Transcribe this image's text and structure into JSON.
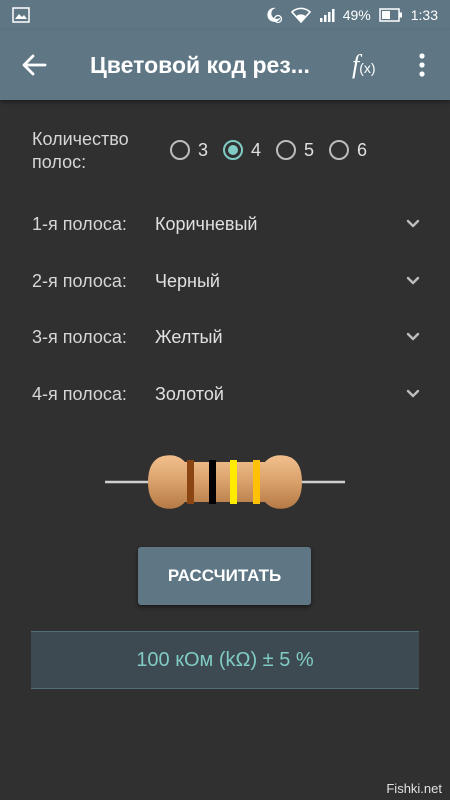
{
  "status_bar": {
    "battery": "49%",
    "time": "1:33",
    "icons": [
      "image-icon",
      "alarm-icon",
      "wifi-icon",
      "signal-icon",
      "battery-icon"
    ]
  },
  "app_bar": {
    "title": "Цветовой код рез...",
    "fx_label": "f",
    "fx_sub": "(x)",
    "icons": [
      "back-arrow-icon",
      "function-icon",
      "more-vert-icon"
    ]
  },
  "band_count": {
    "label": "Количество полос:",
    "options": [
      "3",
      "4",
      "5",
      "6"
    ],
    "selected": "4"
  },
  "bands": [
    {
      "label": "1-я полоса:",
      "value": "Коричневый",
      "color": "#8b4513"
    },
    {
      "label": "2-я полоса:",
      "value": "Черный",
      "color": "#000000"
    },
    {
      "label": "3-я полоса:",
      "value": "Желтый",
      "color": "#ffeb00"
    },
    {
      "label": "4-я полоса:",
      "value": "Золотой",
      "color": "#ffc107"
    }
  ],
  "calculate_button": "РАССЧИТАТЬ",
  "result": "100 кОм (kΩ) ± 5 %",
  "watermark": "Fishki.net",
  "colors": {
    "app_bar": "#5f7785",
    "background": "#303030",
    "accent": "#80cbc4",
    "result_bg": "#3d4a52",
    "resistor_body": "#d9a06b"
  }
}
